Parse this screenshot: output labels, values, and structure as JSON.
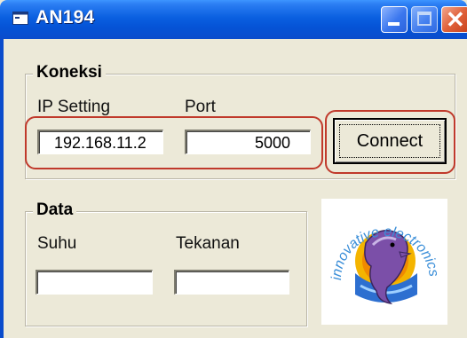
{
  "window": {
    "title": "AN194"
  },
  "koneksi": {
    "title": "Koneksi",
    "ip_label": "IP Setting",
    "port_label": "Port",
    "ip_value": "192.168.11.2",
    "port_value": "5000",
    "connect_label": "Connect"
  },
  "data_group": {
    "title": "Data",
    "suhu_label": "Suhu",
    "tekanan_label": "Tekanan",
    "suhu_value": "",
    "tekanan_value": ""
  },
  "logo": {
    "text": "innovative electronics"
  },
  "colors": {
    "highlight": "#c0392b",
    "titlebar": "#0553d6",
    "face": "#ece9d8"
  },
  "icons": [
    "app-icon",
    "minimize-icon",
    "maximize-icon",
    "close-icon",
    "dolphin-logo"
  ]
}
